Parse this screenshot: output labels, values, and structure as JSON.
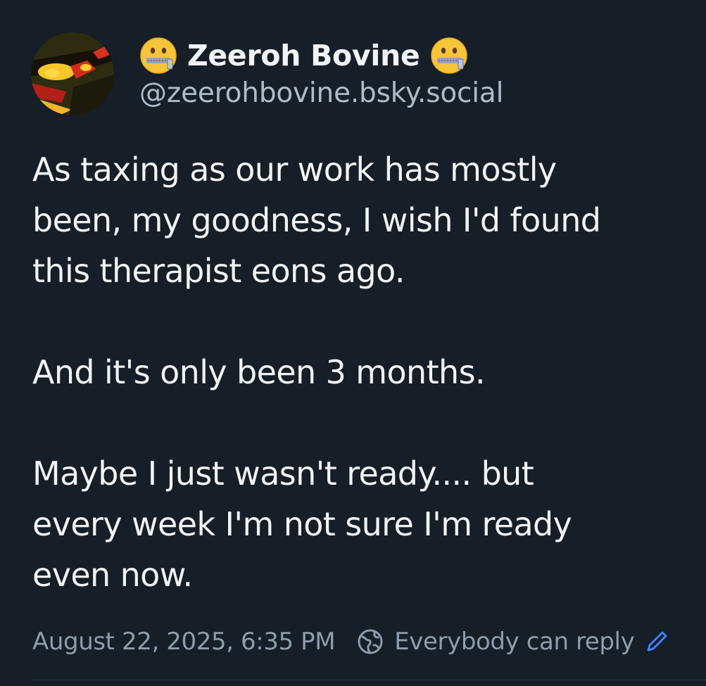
{
  "author": {
    "display_name": "Zeeroh Bovine",
    "handle": "@zeerohbovine.bsky.social",
    "name_emoji": "zipper-mouth-face-icon"
  },
  "post": {
    "lines": [
      "As taxing as our work has mostly",
      "been, my goodness, I wish I'd found",
      "this therapist eons ago.",
      "",
      "And it's only been 3 months.",
      "",
      "Maybe I just wasn't ready.... but",
      "every week I'm not sure I'm ready",
      "even now."
    ]
  },
  "footer": {
    "timestamp": "August 22, 2025, 6:35 PM",
    "reply_setting": "Everybody can reply",
    "globe_icon": "globe-icon",
    "edit_icon": "pencil-icon"
  },
  "colors": {
    "background": "#161e27",
    "text_primary": "#f1f3f5",
    "text_secondary": "#aebbc9",
    "text_muted": "#8e9cac"
  }
}
